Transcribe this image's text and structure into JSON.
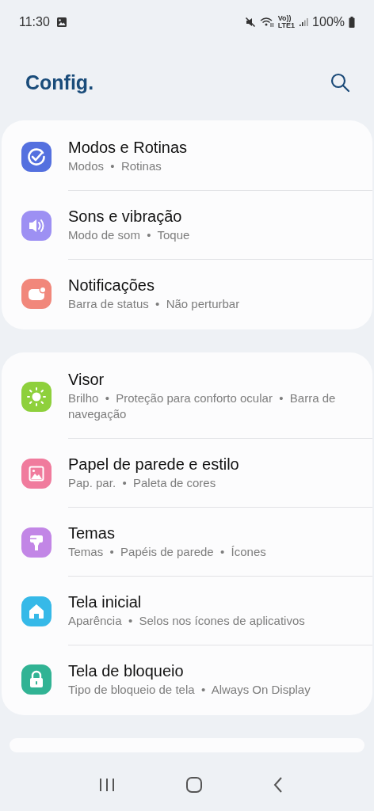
{
  "status_bar": {
    "time": "11:30",
    "network_label": [
      "Vo))",
      "LTE1"
    ],
    "battery": "100%"
  },
  "header": {
    "title": "Config."
  },
  "groups": [
    {
      "items": [
        {
          "kind": "routine",
          "color": "#5470df",
          "title": "Modos e Rotinas",
          "subtitle": "Modos  •  Rotinas"
        },
        {
          "kind": "sound",
          "color": "#9d90f3",
          "title": "Sons e vibração",
          "subtitle": "Modo de som  •  Toque"
        },
        {
          "kind": "notification",
          "color": "#f1877b",
          "title": "Notificações",
          "subtitle": "Barra de status  •  Não perturbar"
        }
      ]
    },
    {
      "items": [
        {
          "kind": "display",
          "color": "#8ed03c",
          "title": "Visor",
          "subtitle": "Brilho  •  Proteção para conforto ocular  •  Barra de navegação"
        },
        {
          "kind": "wallpaper",
          "color": "#f07b9d",
          "title": "Papel de parede e estilo",
          "subtitle": "Pap. par.  •  Paleta de cores"
        },
        {
          "kind": "theme",
          "color": "#c286e6",
          "title": "Temas",
          "subtitle": "Temas  •  Papéis de parede  •  Ícones"
        },
        {
          "kind": "home",
          "color": "#36b9e8",
          "title": "Tela inicial",
          "subtitle": "Aparência  •  Selos nos ícones de aplicativos"
        },
        {
          "kind": "lock",
          "color": "#31b394",
          "title": "Tela de bloqueio",
          "subtitle": "Tipo de bloqueio de tela  •  Always On Display"
        }
      ]
    }
  ]
}
